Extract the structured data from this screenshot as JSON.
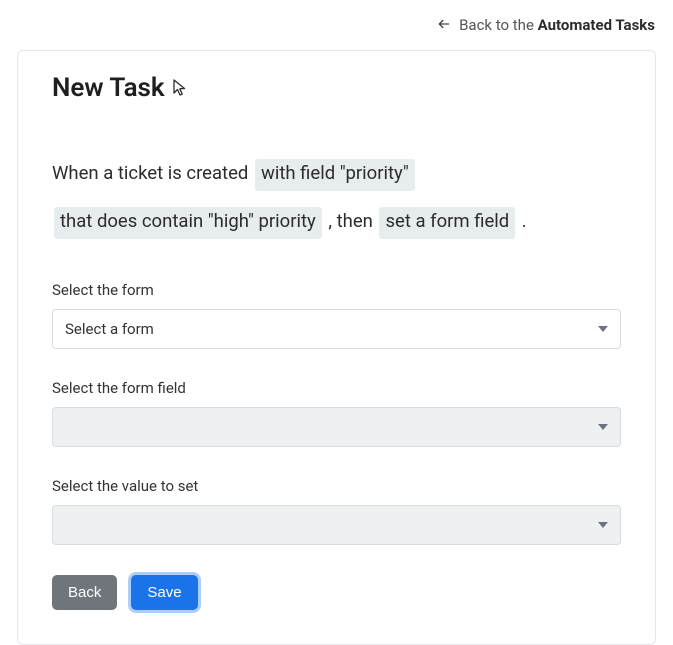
{
  "backlink": {
    "prefix": "Back to the ",
    "bold": "Automated Tasks"
  },
  "title": "New Task",
  "sentence": {
    "part1": "When a ticket is created ",
    "chip1": "with field \"priority\"",
    "chip2": "that does contain \"high\" priority",
    "part2": ", then ",
    "chip3": "set a form field",
    "part3": " ."
  },
  "fields": {
    "form": {
      "label": "Select the form",
      "value": "Select a form"
    },
    "field": {
      "label": "Select the form field",
      "value": ""
    },
    "value": {
      "label": "Select the value to set",
      "value": ""
    }
  },
  "buttons": {
    "back": "Back",
    "save": "Save"
  }
}
